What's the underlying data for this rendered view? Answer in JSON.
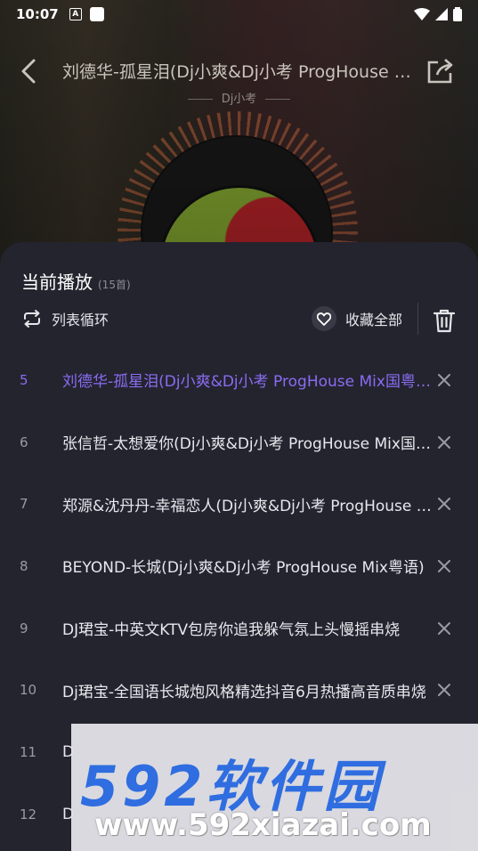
{
  "status_bar": {
    "time": "10:07",
    "a_icon": "A"
  },
  "header": {
    "title": "刘德华-孤星泪(Dj小爽&Dj小考 ProgHouse Mix国粤语)",
    "artist": "Dj小考"
  },
  "sheet": {
    "title": "当前播放",
    "count": "(15首)",
    "mode_label": "列表循环",
    "fav_label": "收藏全部",
    "accent_color": "#8a6cf2",
    "tracks": [
      {
        "num": "5",
        "title": "刘德华-孤星泪(Dj小爽&Dj小考 ProgHouse Mix国粤语)",
        "active": true
      },
      {
        "num": "6",
        "title": "张信哲-太想爱你(Dj小爽&Dj小考 ProgHouse Mix国粤语)"
      },
      {
        "num": "7",
        "title": "郑源&沈丹丹-幸福恋人(Dj小爽&Dj小考 ProgHouse Mix)"
      },
      {
        "num": "8",
        "title": "BEYOND-长城(Dj小爽&Dj小考 ProgHouse Mix粤语)"
      },
      {
        "num": "9",
        "title": "DJ珺宝-中英文KTV包房你追我躲气氛上头慢摇串烧"
      },
      {
        "num": "10",
        "title": "Dj珺宝-全国语长城炮风格精选抖音6月热播高音质串烧"
      },
      {
        "num": "11",
        "title": "D"
      },
      {
        "num": "12",
        "title": "D"
      }
    ]
  },
  "watermark": {
    "top": "592软件园",
    "bottom": "www.592xiazai.com"
  }
}
